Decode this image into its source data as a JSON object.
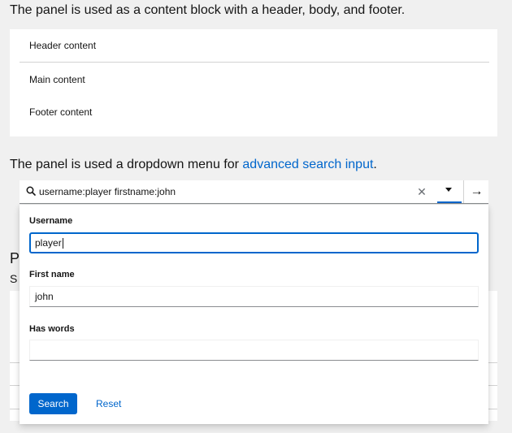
{
  "section1": {
    "description": "The panel is used as a content block with a header, body, and footer.",
    "header": "Header content",
    "body": "Main content",
    "footer": "Footer content"
  },
  "section2": {
    "description_prefix": "The panel is used a dropdown menu for ",
    "description_link": "advanced search input",
    "description_suffix": "."
  },
  "background": {
    "heading_fragment": "P",
    "subheading_fragment": "S"
  },
  "search": {
    "icon": "search-icon",
    "value": "username:player firstname:john",
    "clear_icon": "close-icon",
    "toggle_icon": "caret-down-icon",
    "submit_icon": "arrow-right-icon"
  },
  "advanced": {
    "fields": [
      {
        "label": "Username",
        "value": "player"
      },
      {
        "label": "First name",
        "value": "john"
      },
      {
        "label": "Has words",
        "value": ""
      }
    ],
    "search_label": "Search",
    "reset_label": "Reset"
  },
  "colors": {
    "primary": "#0066cc",
    "border": "#d2d2d2",
    "background": "#f0f0f0"
  }
}
